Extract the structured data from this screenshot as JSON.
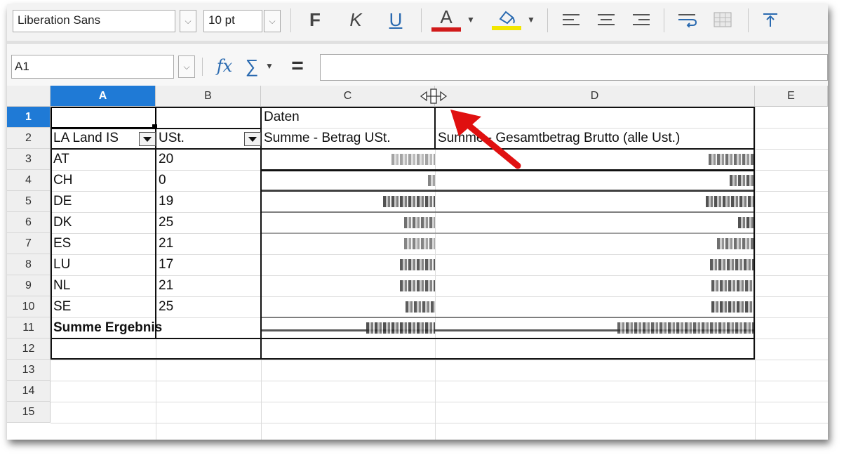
{
  "toolbar": {
    "font_name": "Liberation Sans",
    "font_size": "10 pt",
    "bold_label": "F",
    "italic_label": "K",
    "underline_label": "U",
    "font_color_label": "A",
    "font_color": "#d11a1a",
    "highlight_color": "#f2e600"
  },
  "formula_bar": {
    "cell_ref": "A1",
    "fx_label": "fx",
    "sum_label": "∑",
    "equals_label": "=",
    "formula": ""
  },
  "columns": [
    "A",
    "B",
    "C",
    "D",
    "E"
  ],
  "rows": [
    "1",
    "2",
    "3",
    "4",
    "5",
    "6",
    "7",
    "8",
    "9",
    "10",
    "11",
    "12",
    "13",
    "14",
    "15"
  ],
  "pivot": {
    "data_label": "Daten",
    "header_a": "LA Land IS",
    "header_b": "USt.",
    "header_c": "Summe - Betrag USt.",
    "header_d": "Summe - Gesamtbetrag Brutto (alle Ust.)",
    "rows": [
      {
        "country": "AT",
        "vat": "20"
      },
      {
        "country": "CH",
        "vat": "0"
      },
      {
        "country": "DE",
        "vat": "19"
      },
      {
        "country": "DK",
        "vat": "25"
      },
      {
        "country": "ES",
        "vat": "21"
      },
      {
        "country": "LU",
        "vat": "17"
      },
      {
        "country": "NL",
        "vat": "21"
      },
      {
        "country": "SE",
        "vat": "25"
      }
    ],
    "total_label": "Summe Ergebnis"
  }
}
